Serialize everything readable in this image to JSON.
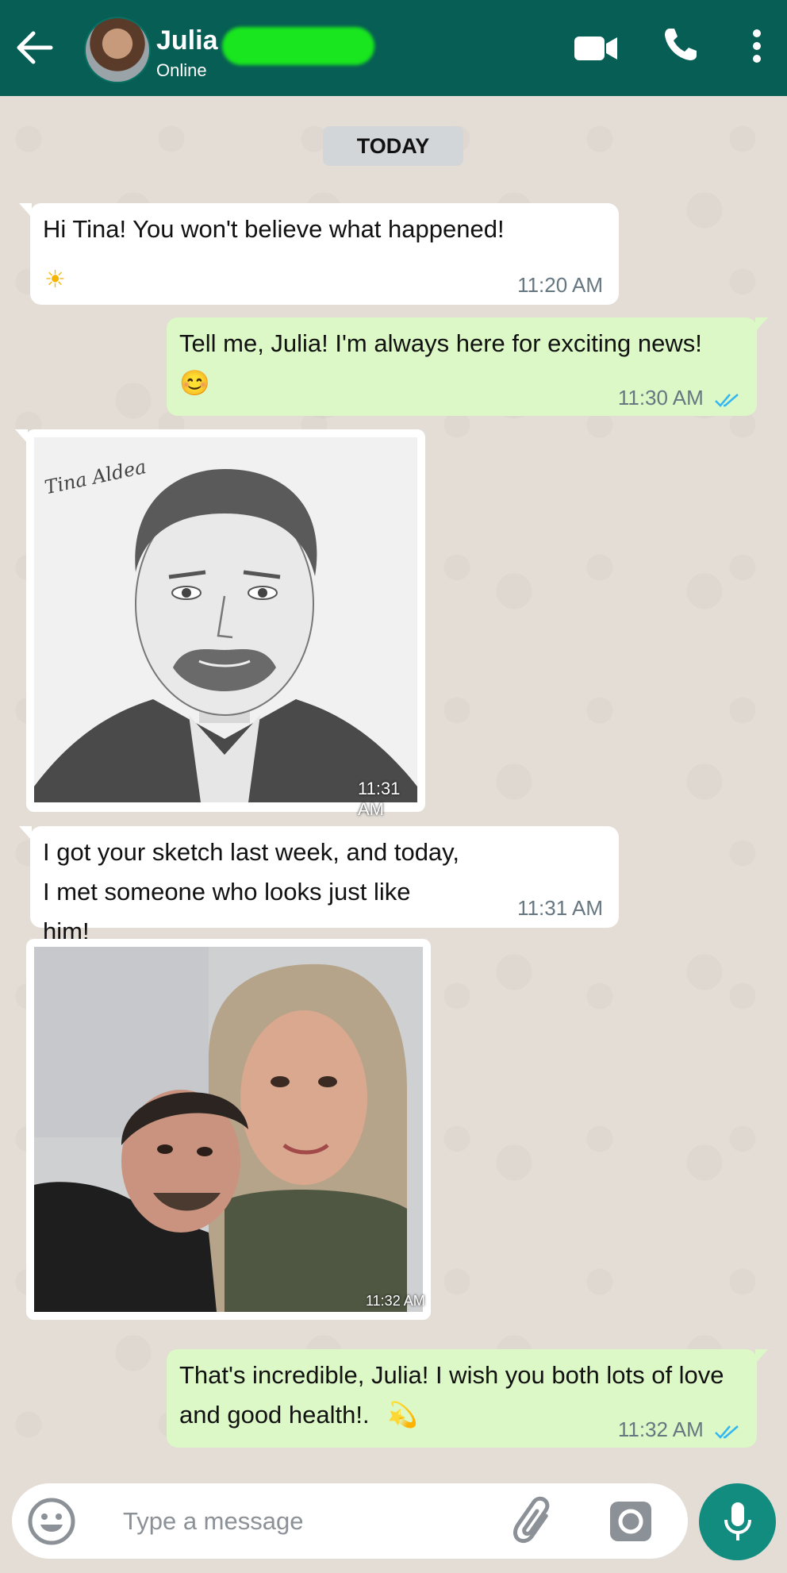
{
  "header": {
    "contact_name": "Julia",
    "status": "Online"
  },
  "chat": {
    "date_label": "TODAY",
    "messages": [
      {
        "direction": "incoming",
        "text": "Hi Tina! You won't believe what happened!",
        "emoji": "☀",
        "time": "11:20 AM"
      },
      {
        "direction": "outgoing",
        "text": "Tell me, Julia! I'm always here for exciting news!",
        "emoji": "😊",
        "time": "11:30 AM",
        "read": true
      },
      {
        "direction": "incoming",
        "type": "image",
        "image_caption_signature": "Tina Aldea",
        "time": "11:31 AM"
      },
      {
        "direction": "incoming",
        "text": "I got your sketch last week, and today, I met someone who looks just like him!",
        "time": "11:31 AM"
      },
      {
        "direction": "incoming",
        "type": "image",
        "time": "11:32 AM"
      },
      {
        "direction": "outgoing",
        "text": "That's incredible, Julia! I wish you both lots of love and good health!.",
        "emoji": "💫",
        "time": "11:32 AM",
        "read": true
      }
    ]
  },
  "composer": {
    "placeholder": "Type a message"
  },
  "colors": {
    "header": "#075e54",
    "outgoing_bubble": "#dcf8c6",
    "incoming_bubble": "#ffffff",
    "chat_background": "#e3ddd6",
    "read_tick": "#34b7f1",
    "mic_button": "#128c7e"
  },
  "icons": [
    "back-arrow-icon",
    "video-call-icon",
    "phone-icon",
    "more-vertical-icon",
    "emoji-icon",
    "attach-icon",
    "camera-icon",
    "mic-icon"
  ]
}
